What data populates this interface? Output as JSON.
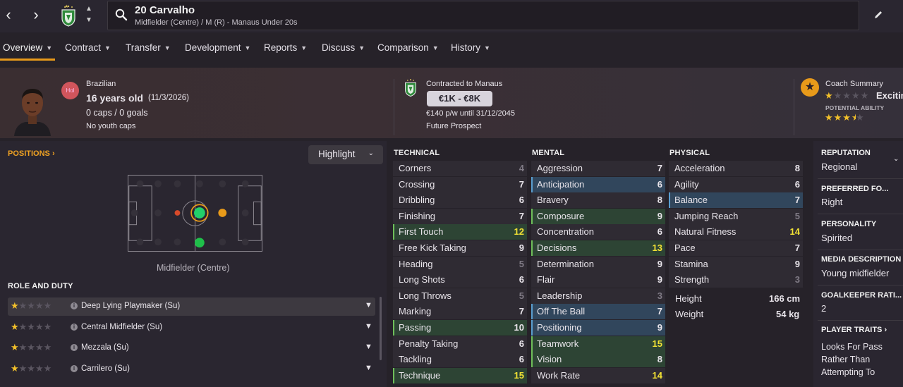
{
  "nav": {
    "back": "‹",
    "forward": "›"
  },
  "player": {
    "number_name": "20 Carvalho",
    "subtitle": "Midfielder (Centre) / M (R) - Manaus Under 20s",
    "nationality": "Brazilian",
    "age_bold": "16 years old",
    "dob": "(11/3/2026)",
    "caps": "0 caps / 0 goals",
    "youth_caps": "No youth caps",
    "status_badge": "Hol"
  },
  "tabs": [
    {
      "label": "Overview"
    },
    {
      "label": "Contract"
    },
    {
      "label": "Transfer"
    },
    {
      "label": "Development"
    },
    {
      "label": "Reports"
    },
    {
      "label": "Discuss"
    },
    {
      "label": "Comparison"
    },
    {
      "label": "History"
    }
  ],
  "contract": {
    "club": "Contracted to Manaus",
    "value_range": "€1K - €8K",
    "wage": "€140 p/w until 31/12/2045",
    "status": "Future Prospect"
  },
  "coach": {
    "title": "Coach Summary",
    "verdict": "Excitin",
    "potential_label": "POTENTIAL ABILITY",
    "current_ability_stars": 1,
    "potential_ability_stars": 3.5
  },
  "positions": {
    "link": "POSITIONS",
    "highlight": "Highlight",
    "main_position": "Midfielder (Centre)"
  },
  "role_duty": {
    "title": "ROLE AND DUTY",
    "roles": [
      {
        "name": "Deep Lying Playmaker (Su)",
        "stars": 1
      },
      {
        "name": "Central Midfielder (Su)",
        "stars": 1
      },
      {
        "name": "Mezzala (Su)",
        "stars": 1
      },
      {
        "name": "Carrilero (Su)",
        "stars": 1
      }
    ]
  },
  "attributes": {
    "technical_title": "TECHNICAL",
    "mental_title": "MENTAL",
    "physical_title": "PHYSICAL",
    "technical": [
      {
        "name": "Corners",
        "value": "4",
        "hl": "",
        "tone": "dim"
      },
      {
        "name": "Crossing",
        "value": "7",
        "hl": "",
        "tone": ""
      },
      {
        "name": "Dribbling",
        "value": "6",
        "hl": "",
        "tone": ""
      },
      {
        "name": "Finishing",
        "value": "7",
        "hl": "",
        "tone": ""
      },
      {
        "name": "First Touch",
        "value": "12",
        "hl": "green",
        "tone": "yel"
      },
      {
        "name": "Free Kick Taking",
        "value": "9",
        "hl": "",
        "tone": ""
      },
      {
        "name": "Heading",
        "value": "5",
        "hl": "",
        "tone": "dim"
      },
      {
        "name": "Long Shots",
        "value": "6",
        "hl": "",
        "tone": ""
      },
      {
        "name": "Long Throws",
        "value": "5",
        "hl": "",
        "tone": "dim"
      },
      {
        "name": "Marking",
        "value": "7",
        "hl": "",
        "tone": ""
      },
      {
        "name": "Passing",
        "value": "10",
        "hl": "green",
        "tone": ""
      },
      {
        "name": "Penalty Taking",
        "value": "6",
        "hl": "",
        "tone": ""
      },
      {
        "name": "Tackling",
        "value": "6",
        "hl": "",
        "tone": ""
      },
      {
        "name": "Technique",
        "value": "15",
        "hl": "green",
        "tone": "yel"
      }
    ],
    "mental": [
      {
        "name": "Aggression",
        "value": "7",
        "hl": "",
        "tone": ""
      },
      {
        "name": "Anticipation",
        "value": "6",
        "hl": "blue",
        "tone": ""
      },
      {
        "name": "Bravery",
        "value": "8",
        "hl": "",
        "tone": ""
      },
      {
        "name": "Composure",
        "value": "9",
        "hl": "green",
        "tone": ""
      },
      {
        "name": "Concentration",
        "value": "6",
        "hl": "",
        "tone": ""
      },
      {
        "name": "Decisions",
        "value": "13",
        "hl": "green",
        "tone": "yel"
      },
      {
        "name": "Determination",
        "value": "9",
        "hl": "",
        "tone": ""
      },
      {
        "name": "Flair",
        "value": "9",
        "hl": "",
        "tone": ""
      },
      {
        "name": "Leadership",
        "value": "3",
        "hl": "",
        "tone": "dim"
      },
      {
        "name": "Off The Ball",
        "value": "7",
        "hl": "blue",
        "tone": ""
      },
      {
        "name": "Positioning",
        "value": "9",
        "hl": "blue",
        "tone": ""
      },
      {
        "name": "Teamwork",
        "value": "15",
        "hl": "green",
        "tone": "yel"
      },
      {
        "name": "Vision",
        "value": "8",
        "hl": "green",
        "tone": ""
      },
      {
        "name": "Work Rate",
        "value": "14",
        "hl": "",
        "tone": "yel"
      }
    ],
    "physical": [
      {
        "name": "Acceleration",
        "value": "8",
        "hl": "",
        "tone": ""
      },
      {
        "name": "Agility",
        "value": "6",
        "hl": "",
        "tone": ""
      },
      {
        "name": "Balance",
        "value": "7",
        "hl": "blue",
        "tone": ""
      },
      {
        "name": "Jumping Reach",
        "value": "5",
        "hl": "",
        "tone": "dim"
      },
      {
        "name": "Natural Fitness",
        "value": "14",
        "hl": "",
        "tone": "yel"
      },
      {
        "name": "Pace",
        "value": "7",
        "hl": "",
        "tone": ""
      },
      {
        "name": "Stamina",
        "value": "9",
        "hl": "",
        "tone": ""
      },
      {
        "name": "Strength",
        "value": "3",
        "hl": "",
        "tone": "dim"
      }
    ],
    "height_label": "Height",
    "height": "166 cm",
    "weight_label": "Weight",
    "weight": "54 kg"
  },
  "side": {
    "reputation_title": "REPUTATION",
    "reputation": "Regional",
    "foot_title": "PREFERRED FO...",
    "foot": "Right",
    "personality_title": "PERSONALITY",
    "personality": "Spirited",
    "media_title": "MEDIA DESCRIPTION",
    "media": "Young midfielder",
    "gk_title": "GOALKEEPER RATI...",
    "gk": "2",
    "traits_title": "PLAYER TRAITS",
    "traits": [
      "Looks For Pass",
      "Rather Than",
      "Attempting To"
    ]
  },
  "colors": {
    "accent": "#e89a1a",
    "blue_highlight": "#31465c",
    "green_highlight": "#2d4434",
    "high_value": "#f2e234"
  }
}
